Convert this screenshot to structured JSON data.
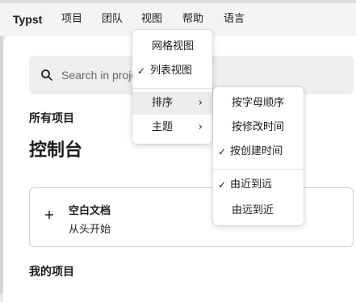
{
  "menubar": {
    "brand": "Typst",
    "items": [
      "项目",
      "团队",
      "视图",
      "帮助",
      "语言"
    ]
  },
  "search": {
    "placeholder": "Search in projects"
  },
  "headings": {
    "all_projects": "所有项目",
    "dashboard": "控制台",
    "my_projects": "我的项目"
  },
  "blank_card": {
    "title": "空白文档",
    "subtitle": "从头开始"
  },
  "view_menu": {
    "grid": "网格视图",
    "list": "列表视图",
    "sort": "排序",
    "theme": "主题",
    "selected": "列表视图"
  },
  "sort_menu": {
    "alphabetical": "按字母顺序",
    "modified": "按修改时间",
    "created": "按创建时间",
    "near_to_far": "由近到远",
    "far_to_near": "由远到近",
    "selected_key": "按创建时间",
    "selected_order": "由近到远"
  },
  "icons": {
    "check": "checkmark-icon",
    "chevron": "chevron-right-icon",
    "search": "search-icon",
    "plus": "plus-icon"
  }
}
